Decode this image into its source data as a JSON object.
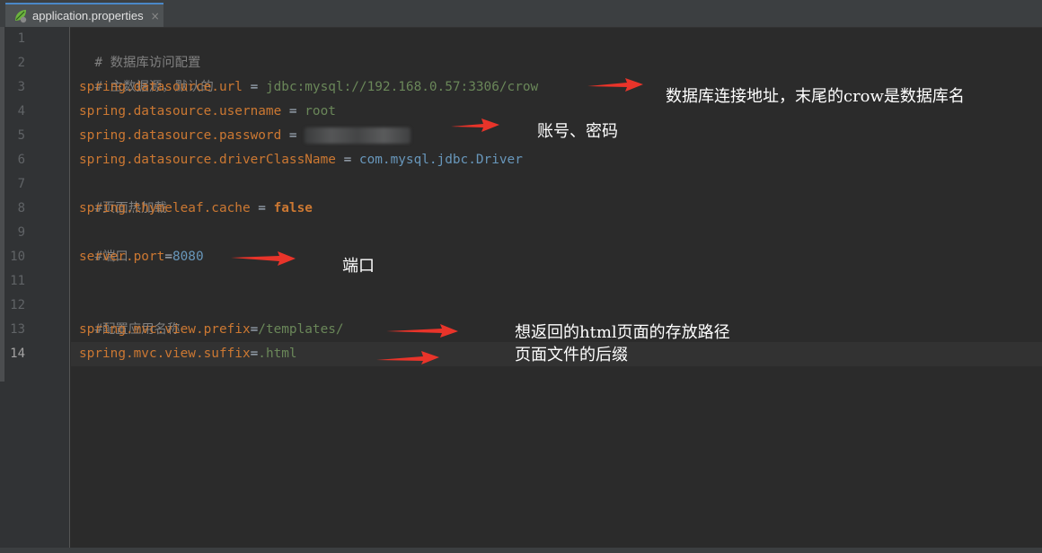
{
  "tab": {
    "filename": "application.properties",
    "file_icon": "spring-leaf-icon",
    "close": "×"
  },
  "lines": [
    {
      "number": "1",
      "comment": "# 数据库访问配置"
    },
    {
      "number": "2",
      "comment": "# 主数据源，默认的"
    },
    {
      "number": "3",
      "key": "spring.datasource.url",
      "eq": " = ",
      "value": "jdbc:mysql://192.168.0.57:3306/crow"
    },
    {
      "number": "4",
      "key": "spring.datasource.username",
      "eq": " = ",
      "value": "root"
    },
    {
      "number": "5",
      "key": "spring.datasource.password",
      "eq": " = "
    },
    {
      "number": "6",
      "key": "spring.datasource.driverClassName",
      "eq": " = ",
      "value": "com.mysql.jdbc.Driver"
    },
    {
      "number": "7",
      "comment": "#页面热加载"
    },
    {
      "number": "8",
      "key": "spring.thymeleaf.cache",
      "eq": " = ",
      "value": "false"
    },
    {
      "number": "9",
      "comment": "#端口"
    },
    {
      "number": "10",
      "key": "server.port",
      "eq": "=",
      "value": "8080"
    },
    {
      "number": "11"
    },
    {
      "number": "12",
      "comment": "#配置应用名称"
    },
    {
      "number": "13",
      "key": "spring.mvc.view.prefix",
      "eq": "=",
      "value": "/templates/"
    },
    {
      "number": "14",
      "key": "spring.mvc.view.suffix",
      "eq": "=",
      "value": ".html"
    }
  ],
  "annotations": {
    "url": "数据库连接地址，末尾的crow是数据库名",
    "account": "账号、密码",
    "port": "端口",
    "prefix": "想返回的html页面的存放路径",
    "suffix": "页面文件的后缀"
  },
  "colors": {
    "background": "#2b2b2b",
    "gutter": "#313335",
    "key": "#cc7832",
    "string_value": "#6a8759",
    "number": "#6897bb",
    "comment": "#808080",
    "arrow": "#e8342a"
  }
}
